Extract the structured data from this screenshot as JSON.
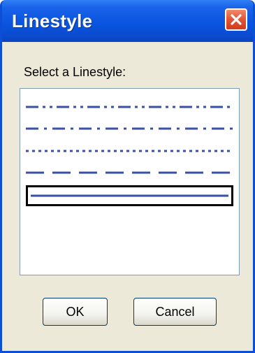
{
  "window": {
    "title": "Linestyle",
    "close_icon": "close-icon"
  },
  "content": {
    "prompt": "Select a Linestyle:",
    "line_color": "#3a4fa8",
    "linestyles": [
      {
        "style": "dash-dot-dot",
        "selected": false
      },
      {
        "style": "dash-dot",
        "selected": false
      },
      {
        "style": "dotted",
        "selected": false
      },
      {
        "style": "dashed",
        "selected": false
      },
      {
        "style": "solid",
        "selected": true
      }
    ]
  },
  "buttons": {
    "ok": "OK",
    "cancel": "Cancel"
  },
  "colors": {
    "titlebar": "#0a55e0",
    "close_button": "#e4573a",
    "dialog_background": "#ece9d8",
    "selection_border": "#000000"
  }
}
